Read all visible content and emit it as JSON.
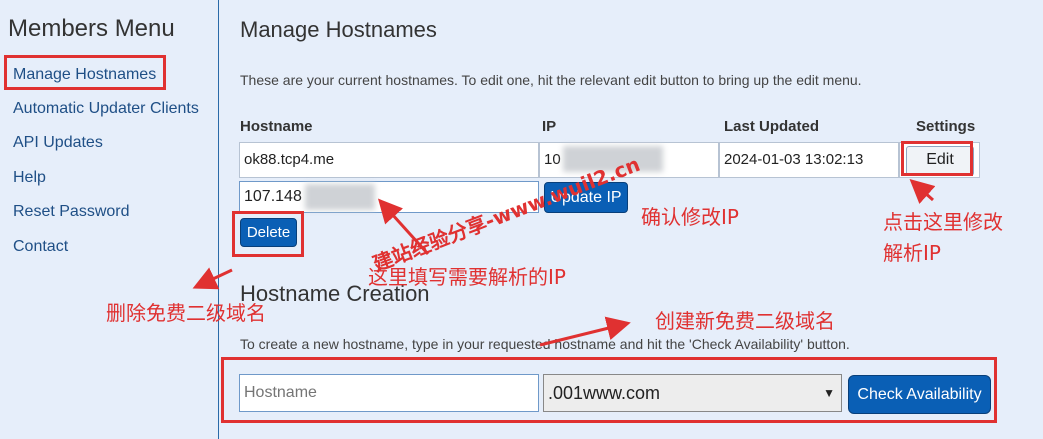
{
  "sidebar": {
    "title": "Members Menu",
    "items": [
      {
        "label": "Manage Hostnames"
      },
      {
        "label": "Automatic Updater Clients"
      },
      {
        "label": "API Updates"
      },
      {
        "label": "Help"
      },
      {
        "label": "Reset Password"
      },
      {
        "label": "Contact"
      }
    ]
  },
  "manage": {
    "title": "Manage Hostnames",
    "intro": "These are your current hostnames. To edit one, hit the relevant edit button to bring up the edit menu.",
    "headers": {
      "hostname": "Hostname",
      "ip": "IP",
      "updated": "Last Updated",
      "settings": "Settings"
    },
    "row": {
      "hostname": "ok88.tcp4.me",
      "ip": "10",
      "updated": "2024-01-03 13:02:13",
      "edit": "Edit"
    },
    "edit_ip_value": "107.148",
    "update_ip": "Update IP",
    "delete": "Delete"
  },
  "creation": {
    "title": "Hostname Creation",
    "intro": "To create a new hostname, type in your requested hostname and hit the 'Check Availability' button.",
    "hostname_placeholder": "Hostname",
    "domain_selected": ".001www.com",
    "check": "Check Availability"
  },
  "annotations": {
    "watermark": "建站经验分享-www.wuil2.cn",
    "confirm_ip": "确认修改IP",
    "click_edit_1": "点击这里修改",
    "click_edit_2": "解析IP",
    "fill_ip": "这里填写需要解析的IP",
    "delete_sub": "删除免费二级域名",
    "create_sub": "创建新免费二级域名"
  },
  "colors": {
    "accent": "#0a5fb5",
    "annotation": "#e03131",
    "background": "#e6eefa"
  }
}
